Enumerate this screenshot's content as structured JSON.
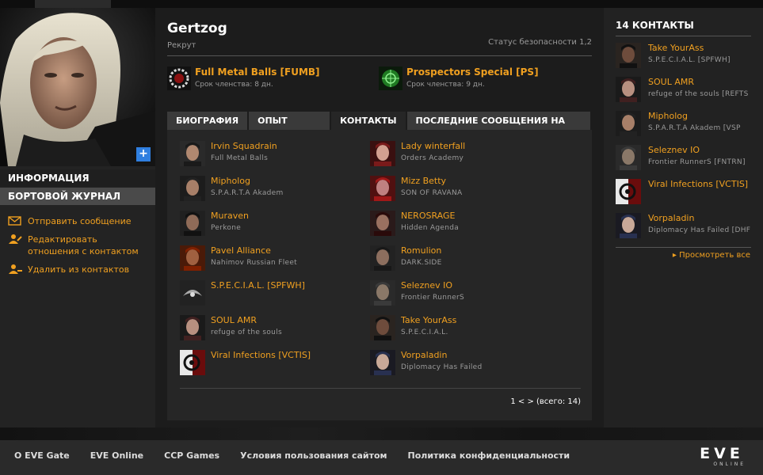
{
  "character": {
    "name": "Gertzog",
    "role": "Рекрут",
    "security_status": "Статус безопасности 1,2"
  },
  "sidebar": {
    "info_label": "ИНФОРМАЦИЯ",
    "log_label": "БОРТОВОЙ ЖУРНАЛ",
    "actions": [
      {
        "label": "Отправить сообщение",
        "icon": "envelope-icon"
      },
      {
        "label": "Редактировать отношения с контактом",
        "icon": "edit-contact-icon"
      },
      {
        "label": "Удалить из контактов",
        "icon": "remove-contact-icon"
      }
    ]
  },
  "corps": [
    {
      "name": "Full Metal Balls [FUMB]",
      "membership": "Срок членства: 8 дн."
    },
    {
      "name": "Prospectors Special [PS]",
      "membership": "Срок членства: 9 дн."
    }
  ],
  "tabs": [
    {
      "label": "БИОГРАФИЯ"
    },
    {
      "label": "ОПЫТ РАБОТЫ"
    },
    {
      "label": "КОНТАКТЫ",
      "active": true
    },
    {
      "label": "ПОСЛЕДНИЕ СООБЩЕНИЯ НА ФОРУМЕ"
    }
  ],
  "contacts": [
    {
      "name": "Irvin Squadrain",
      "corp": "Full Metal Balls"
    },
    {
      "name": "Lady winterfall",
      "corp": "Orders Academy"
    },
    {
      "name": "Mipholog",
      "corp": "S.P.A.R.T.A Akadem"
    },
    {
      "name": "Mizz Betty",
      "corp": "SON OF RAVANA"
    },
    {
      "name": "Muraven",
      "corp": "Perkone"
    },
    {
      "name": "NEROSRAGE",
      "corp": "Hidden Agenda"
    },
    {
      "name": "Pavel Alliance",
      "corp": "Nahimov Russian Fleet"
    },
    {
      "name": "Romulion",
      "corp": "DARK.SIDE"
    },
    {
      "name": "S.P.E.C.I.A.L. [SPFWH]",
      "corp": ""
    },
    {
      "name": "Seleznev IO",
      "corp": "Frontier RunnerS"
    },
    {
      "name": "SOUL AMR",
      "corp": "refuge of the souls"
    },
    {
      "name": "Take YourAss",
      "corp": "S.P.E.C.I.A.L."
    },
    {
      "name": "Viral Infections [VCTIS]",
      "corp": ""
    },
    {
      "name": "Vorpaladin",
      "corp": "Diplomacy Has Failed"
    }
  ],
  "pager": "1 < > (всего: 14)",
  "right": {
    "title": "14 КОНТАКТЫ",
    "contacts": [
      {
        "name": "Take YourAss",
        "corp": "S.P.E.C.I.A.L. [SPFWH]"
      },
      {
        "name": "SOUL AMR",
        "corp": "refuge of the souls [REFTS"
      },
      {
        "name": "Mipholog",
        "corp": "S.P.A.R.T.A Akadem [VSP"
      },
      {
        "name": "Seleznev IO",
        "corp": "Frontier RunnerS [FNTRN]"
      },
      {
        "name": "Viral Infections [VCTIS]",
        "corp": ""
      },
      {
        "name": "Vorpaladin",
        "corp": "Diplomacy Has Failed [DHF"
      }
    ],
    "view_all": "Просмотреть все"
  },
  "footer": {
    "links": [
      "О EVE Gate",
      "EVE Online",
      "CCP Games",
      "Условия пользования сайтом",
      "Политика конфиденциальности"
    ],
    "logo_text": "EVE",
    "logo_sub": "ONLINE"
  },
  "colors": {
    "accent": "#f0a020",
    "add_button": "#2f7fe0"
  }
}
